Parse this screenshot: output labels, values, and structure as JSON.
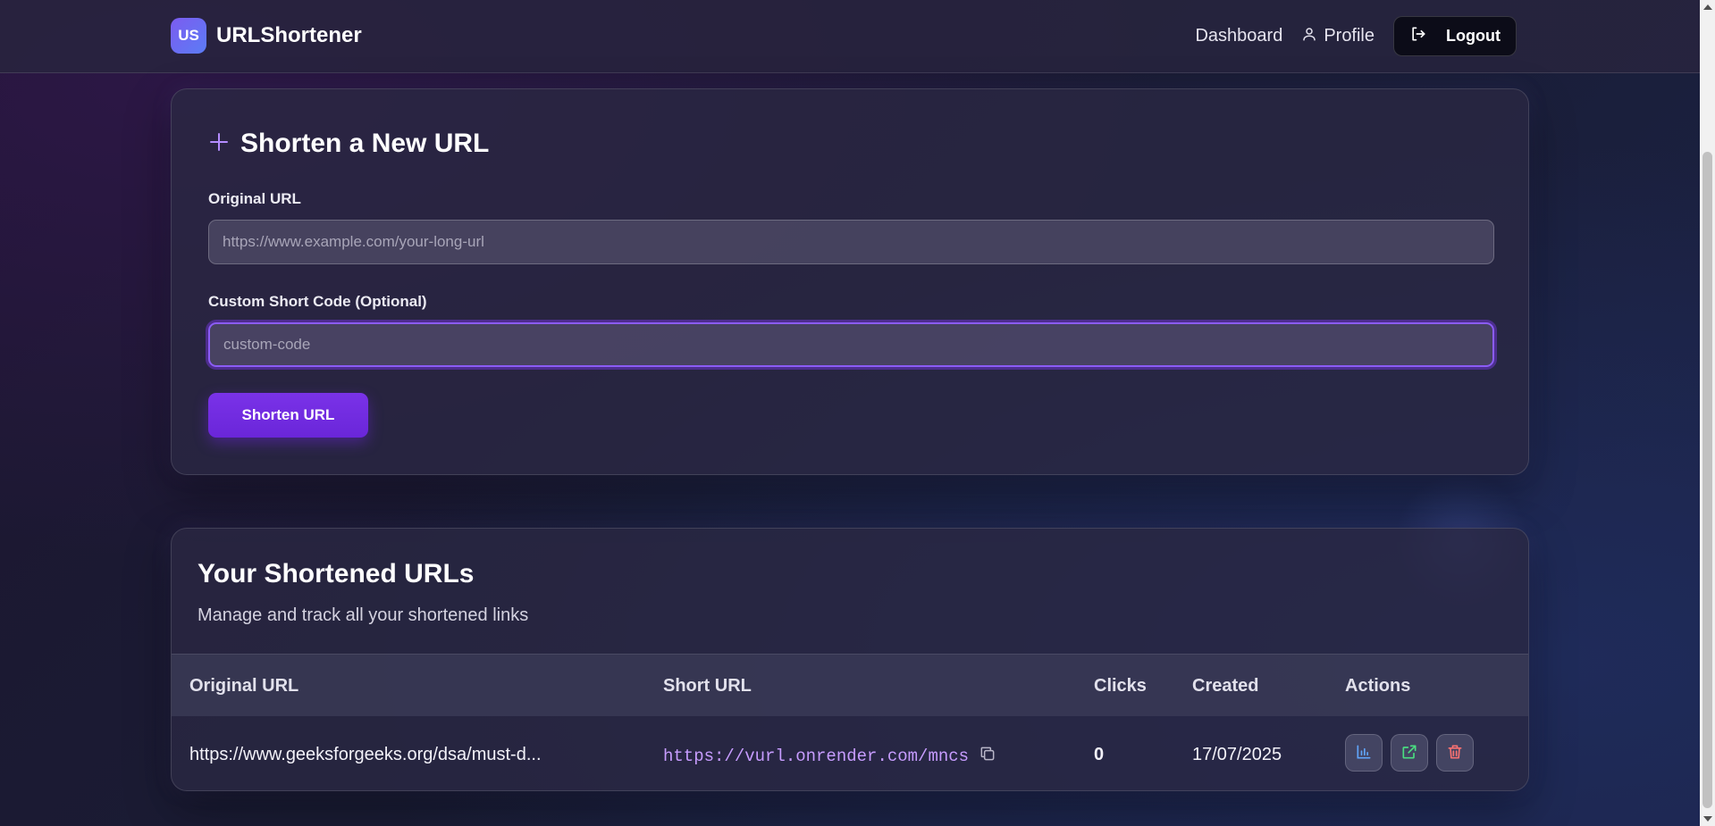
{
  "navbar": {
    "logo_text": "US",
    "brand": "URLShortener",
    "dashboard_label": "Dashboard",
    "profile_label": "Profile",
    "logout_label": "Logout"
  },
  "shorten_form": {
    "title": "Shorten a New URL",
    "original_url_label": "Original URL",
    "original_url_placeholder": "https://www.example.com/your-long-url",
    "original_url_value": "",
    "custom_code_label": "Custom Short Code (Optional)",
    "custom_code_placeholder": "custom-code",
    "custom_code_value": "",
    "submit_label": "Shorten URL"
  },
  "urls_list": {
    "title": "Your Shortened URLs",
    "subtitle": "Manage and track all your shortened links",
    "columns": [
      "Original URL",
      "Short URL",
      "Clicks",
      "Created",
      "Actions"
    ],
    "rows": [
      {
        "original_url": "https://www.geeksforgeeks.org/dsa/must-d...",
        "short_url": "https://vurl.onrender.com/mncs",
        "clicks": "0",
        "created": "17/07/2025",
        "actions": [
          "analytics-icon",
          "external-link-icon",
          "trash-icon"
        ]
      }
    ]
  },
  "colors": {
    "accent": "#7c3aed",
    "short_url": "#c79cff",
    "analytics_icon": "#60a5fa",
    "external_icon": "#4ade80",
    "trash_icon": "#f87171"
  }
}
